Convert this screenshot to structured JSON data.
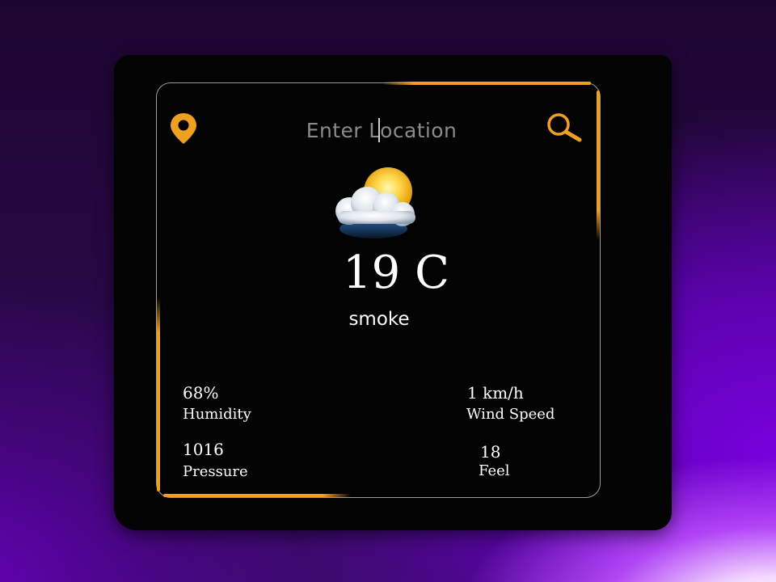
{
  "search": {
    "placeholder": "Enter Location"
  },
  "weather": {
    "temperature": "19 C",
    "condition": "smoke",
    "icon": "sun-cloud-icon"
  },
  "stats": {
    "humidity": {
      "value": "68%",
      "label": "Humidity"
    },
    "wind": {
      "value": "1 km/h",
      "label": "Wind Speed"
    },
    "pressure": {
      "value": "1016",
      "label": "Pressure"
    },
    "feel": {
      "value": "18",
      "label": "Feel"
    }
  },
  "colors": {
    "accent": "#f0a021",
    "card": "#030303",
    "border": "#9b9b9b",
    "text": "#ffffff",
    "placeholder": "#8a8a8a"
  }
}
